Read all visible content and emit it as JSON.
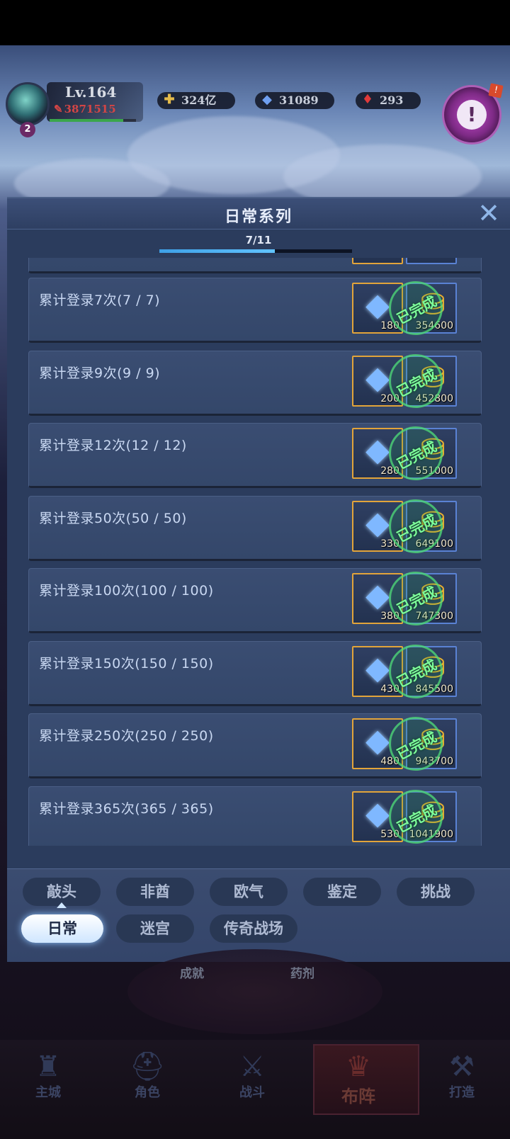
{
  "hud": {
    "level": "Lv.164",
    "power": "3871515",
    "xp_progress": 0.85,
    "avatar_badge": "2",
    "resources": [
      {
        "icon": "gold-coin-icon",
        "value": "324亿"
      },
      {
        "icon": "diamond-icon",
        "value": "31089"
      },
      {
        "icon": "ruby-icon",
        "value": "293"
      }
    ]
  },
  "panel": {
    "title": "日常系列",
    "progress_text": "7/11",
    "progress": 0.6,
    "close_icon": "close-icon"
  },
  "tasks": [
    {
      "title": "累计登录7次(7 / 7)",
      "gem_amount": "180",
      "gold_amount": "354600",
      "status": "已完成"
    },
    {
      "title": "累计登录9次(9 / 9)",
      "gem_amount": "200",
      "gold_amount": "452800",
      "status": "已完成"
    },
    {
      "title": "累计登录12次(12 / 12)",
      "gem_amount": "280",
      "gold_amount": "551000",
      "status": "已完成"
    },
    {
      "title": "累计登录50次(50 / 50)",
      "gem_amount": "330",
      "gold_amount": "649100",
      "status": "已完成"
    },
    {
      "title": "累计登录100次(100 / 100)",
      "gem_amount": "380",
      "gold_amount": "747300",
      "status": "已完成"
    },
    {
      "title": "累计登录150次(150 / 150)",
      "gem_amount": "430",
      "gold_amount": "845500",
      "status": "已完成"
    },
    {
      "title": "累计登录250次(250 / 250)",
      "gem_amount": "480",
      "gold_amount": "943700",
      "status": "已完成"
    },
    {
      "title": "累计登录365次(365 / 365)",
      "gem_amount": "530",
      "gold_amount": "1041900",
      "status": "已完成"
    }
  ],
  "tabs_row1": [
    "敲头",
    "非酋",
    "欧气",
    "鉴定",
    "挑战"
  ],
  "tabs_row2": [
    "日常",
    "迷宫",
    "传奇战场"
  ],
  "active_tab": "日常",
  "hub_labels": [
    "成就",
    "药剂"
  ],
  "bottom_nav": [
    {
      "label": "主城",
      "icon": "castle-icon"
    },
    {
      "label": "角色",
      "icon": "helmet-icon"
    },
    {
      "label": "战斗",
      "icon": "swords-icon"
    },
    {
      "label": "布阵",
      "icon": "formation-icon",
      "active": true
    },
    {
      "label": "打造",
      "icon": "anvil-icon"
    }
  ]
}
